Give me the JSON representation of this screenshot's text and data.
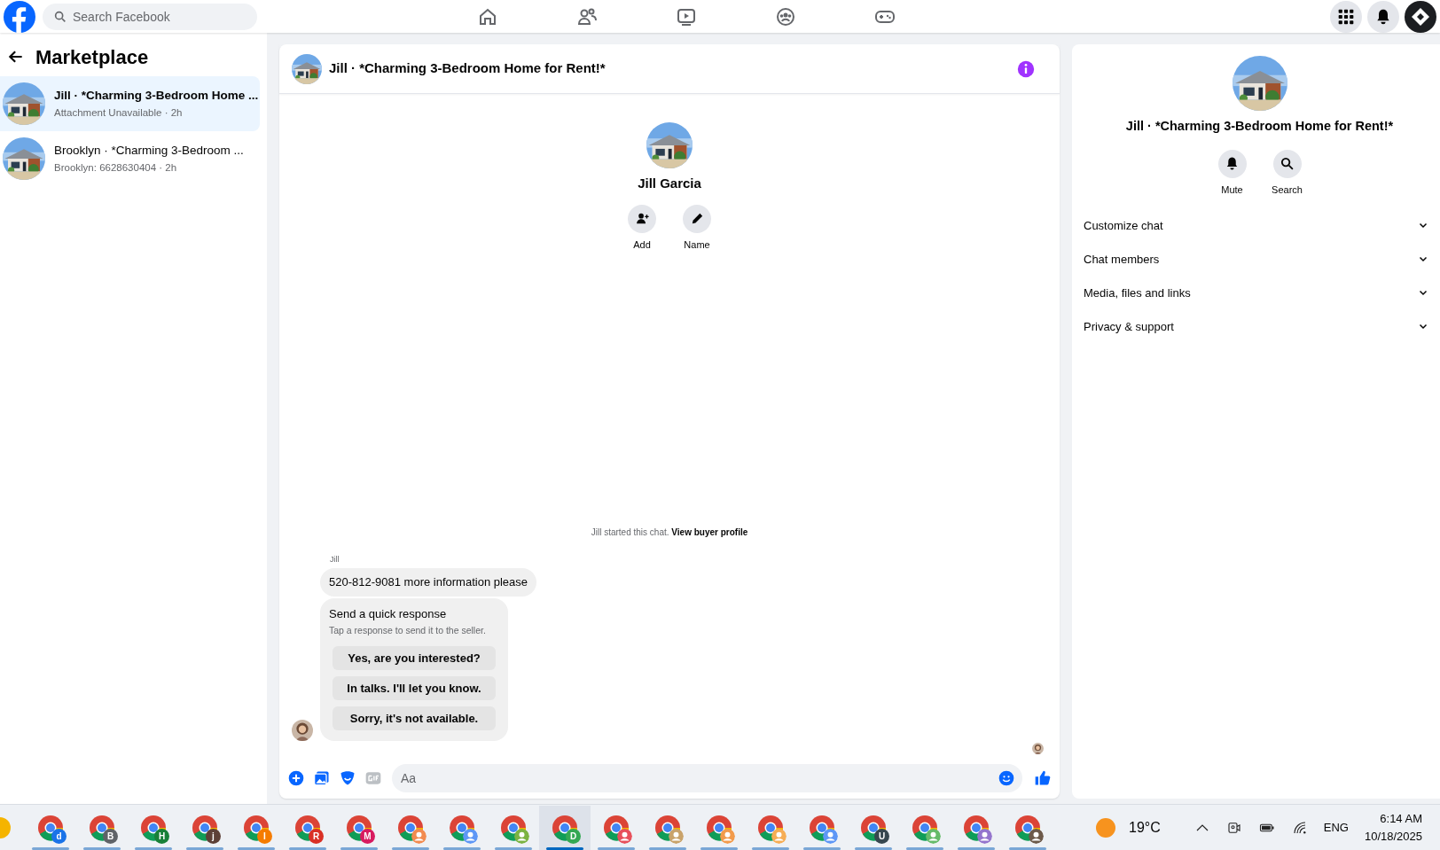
{
  "top_bar": {
    "search": {
      "placeholder": "Search Facebook"
    },
    "nav": [
      {
        "kind": "home"
      },
      {
        "kind": "friends"
      },
      {
        "kind": "video"
      },
      {
        "kind": "groups"
      },
      {
        "kind": "gaming"
      }
    ]
  },
  "sidebar": {
    "title": "Marketplace",
    "items": [
      {
        "title": "Jill · *Charming 3-Bedroom Home ...",
        "subtitle": "Attachment Unavailable · 2h",
        "selected": true
      },
      {
        "title": "Brooklyn · *Charming 3-Bedroom ...",
        "subtitle": "Brooklyn: 6628630404 · 2h",
        "selected": false
      }
    ]
  },
  "chat": {
    "title": "Jill · *Charming 3-Bedroom Home for Rent!*",
    "profile_name": "Jill Garcia",
    "actions": [
      {
        "kind": "add",
        "label": "Add"
      },
      {
        "kind": "name",
        "label": "Name"
      }
    ],
    "notice": "Jill started this chat. **View buyer profile**",
    "sender": "Jill",
    "message": "520-812-9081 more information please",
    "quick_response": {
      "title": "Send a quick response",
      "hint": "Tap a response to send it to the seller.",
      "options": [
        "Yes, are you interested?",
        "In talks. I'll let you know.",
        "Sorry, it's not available."
      ]
    },
    "composer": {
      "placeholder": "Aa"
    }
  },
  "details": {
    "title": "Jill · *Charming 3-Bedroom Home for Rent!*",
    "actions": [
      {
        "kind": "mute",
        "label": "Mute"
      },
      {
        "kind": "search",
        "label": "Search"
      }
    ],
    "sections": [
      {
        "label": "Customize chat",
        "expanded": false
      },
      {
        "label": "Chat members",
        "expanded": false
      },
      {
        "label": "Media, files and links",
        "expanded": false
      },
      {
        "label": "Privacy & support",
        "expanded": false
      }
    ]
  },
  "taskbar": {
    "apps": [
      {
        "letter": "d",
        "color": "#1a73e8",
        "selected": false
      },
      {
        "letter": "B",
        "color": "#5f6368",
        "selected": false
      },
      {
        "letter": "H",
        "color": "#188038",
        "selected": false
      },
      {
        "letter": "j",
        "color": "#5d4037",
        "selected": false
      },
      {
        "letter": "I",
        "color": "#f57c00",
        "selected": false
      },
      {
        "letter": "R",
        "color": "#d93025",
        "selected": false
      },
      {
        "letter": "M",
        "color": "#d81b60",
        "selected": false
      },
      {
        "color": "#f28b50",
        "selected": false
      },
      {
        "color": "#5e97f6",
        "selected": false
      },
      {
        "color": "#7cb342",
        "selected": false
      },
      {
        "letter": "D",
        "color": "#34a853",
        "selected": true
      },
      {
        "color": "#e8505b",
        "selected": false
      },
      {
        "color": "#c9a36b",
        "selected": false
      },
      {
        "color": "#f29b4c",
        "selected": false
      },
      {
        "color": "#f6ad55",
        "selected": false
      },
      {
        "color": "#5e97f6",
        "selected": false
      },
      {
        "letter": "U",
        "color": "#37474f",
        "selected": false
      },
      {
        "color": "#66bb6a",
        "selected": false
      },
      {
        "color": "#9575cd",
        "selected": false
      },
      {
        "color": "#6d5a4a",
        "selected": false
      }
    ],
    "weather": "19°C",
    "language": "ENG",
    "time": "6:14 AM",
    "date": "10/18/2025"
  }
}
